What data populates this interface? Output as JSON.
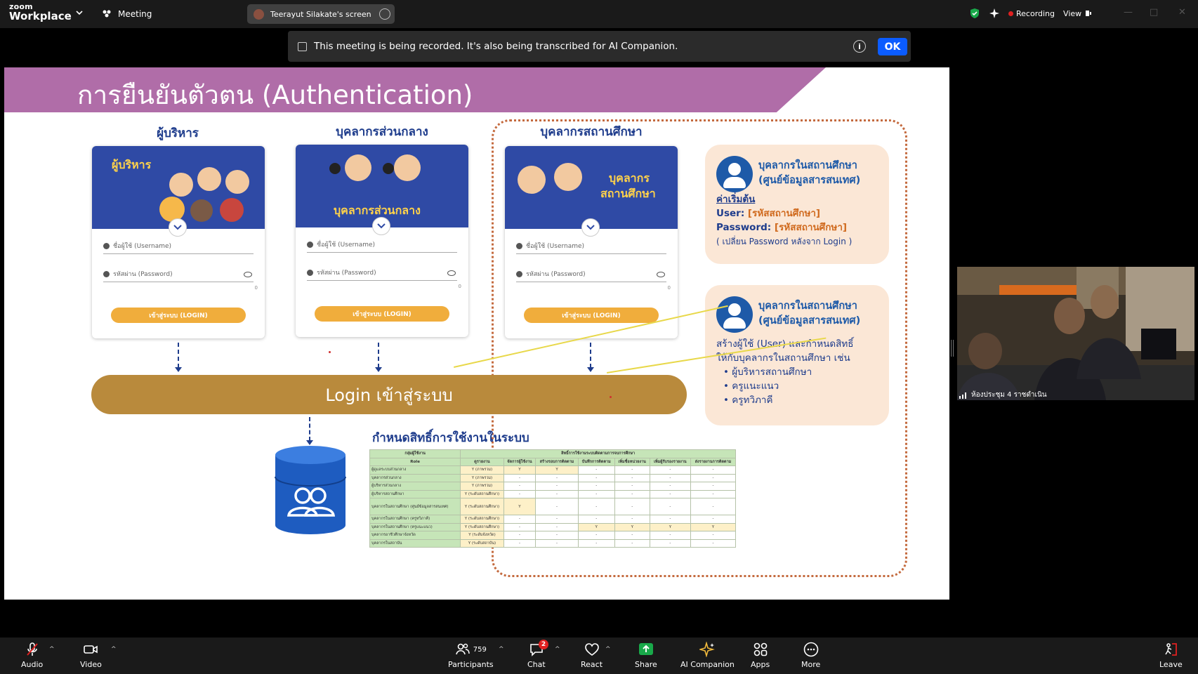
{
  "topbar": {
    "logo_line1": "zoom",
    "logo_line2": "Workplace",
    "meeting_label": "Meeting",
    "share_tab_label": "Teerayut Silakate's screen",
    "recording_label": "Recording",
    "view_label": "View"
  },
  "notice": {
    "text": "This meeting is being recorded. It's also being transcribed for AI Companion.",
    "info_glyph": "i",
    "ok_label": "OK"
  },
  "slide": {
    "title": "การยืนยันตัวตน (Authentication)",
    "columns": [
      {
        "heading": "ผู้บริหาร",
        "image_label": "ผู้บริหาร",
        "username_placeholder": "ชื่อผู้ใช้ (Username)",
        "password_placeholder": "รหัสผ่าน (Password)",
        "counter": "0",
        "login_label": "เข้าสู่ระบบ (LOGIN)"
      },
      {
        "heading": "บุคลากรส่วนกลาง",
        "image_label": "บุคลากรส่วนกลาง",
        "username_placeholder": "ชื่อผู้ใช้ (Username)",
        "password_placeholder": "รหัสผ่าน (Password)",
        "counter": "0",
        "login_label": "เข้าสู่ระบบ (LOGIN)"
      },
      {
        "heading": "บุคลากรสถานศึกษา",
        "image_label_1": "บุคลากร",
        "image_label_2": "สถานศึกษา",
        "username_placeholder": "ชื่อผู้ใช้ (Username)",
        "password_placeholder": "รหัสผ่าน (Password)",
        "counter": "0",
        "login_label": "เข้าสู่ระบบ (LOGIN)"
      }
    ],
    "login_bar": "Login เข้าสู่ระบบ",
    "info_card_1": {
      "title_1": "บุคลากรในสถานศึกษา",
      "title_2": "(ศูนย์ข้อมูลสารสนเทศ)",
      "default_heading": "ค่าเริ่มต้น",
      "user_label": "User",
      "user_value": "[รหัสสถานศึกษา]",
      "password_label": "Password",
      "password_value": "[รหัสสถานศึกษา]",
      "note": "( เปลี่ยน Password หลังจาก Login )"
    },
    "info_card_2": {
      "title_1": "บุคลากรในสถานศึกษา",
      "title_2": "(ศูนย์ข้อมูลสารสนเทศ)",
      "desc_1": "สร้างผู้ใช้ (User) และกำหนดสิทธิ์",
      "desc_2": "ให้กับบุคลากรในสถานศึกษา เช่น",
      "items": [
        "ผู้บริหารสถานศึกษา",
        "ครูแนะแนว",
        "ครูทวิภาคี"
      ]
    },
    "permissions_title": "กำหนดสิทธิ์การใช้งานในระบบ",
    "permissions_table": {
      "header_row_1": [
        "กลุ่มผู้ใช้งาน",
        "สิทธิ์การใช้งานระบบติดตามการจบการศึกษา"
      ],
      "header_row_2": [
        "Role",
        "ดูรายงาน",
        "จัดการผู้ใช้งาน",
        "สร้างรอบการติดตาม",
        "บันทึกการติดตาม",
        "เพิ่มชื่อหน่วยงาน",
        "เพิ่มผู้รับรองรายงาน",
        "ส่งรายงานการติดตาม"
      ],
      "rows": [
        {
          "role": "ผู้ดูแลระบบส่วนกลาง",
          "cells": [
            "Y (ภาพรวม)",
            "Y",
            "Y",
            "-",
            "-",
            "-",
            "-"
          ]
        },
        {
          "role": "บุคลากรส่วนกลาง",
          "cells": [
            "Y (ภาพรวม)",
            "-",
            "-",
            "-",
            "-",
            "-",
            "-"
          ]
        },
        {
          "role": "ผู้บริหารส่วนกลาง",
          "cells": [
            "Y (ภาพรวม)",
            "-",
            "-",
            "-",
            "-",
            "-",
            "-"
          ]
        },
        {
          "role": "ผู้บริหารสถานศึกษา",
          "cells": [
            "Y (ระดับสถานศึกษา)",
            "-",
            "-",
            "-",
            "-",
            "-",
            "-"
          ]
        },
        {
          "role": "บุคลากรในสถานศึกษา (ศูนย์ข้อมูลสารสนเทศ)",
          "cells": [
            "Y (ระดับสถานศึกษา)",
            "Y",
            "-",
            "-",
            "-",
            "-",
            "-"
          ],
          "tall": true
        },
        {
          "role": "บุคลากรในสถานศึกษา (ครูทวิภาคี)",
          "cells": [
            "Y (ระดับสถานศึกษา)",
            "-",
            "-",
            "-",
            "-",
            "-",
            "-"
          ]
        },
        {
          "role": "บุคลากรในสถานศึกษา (ครูแนะแนว)",
          "cells": [
            "Y (ระดับสถานศึกษา)",
            "-",
            "-",
            "Y",
            "Y",
            "Y",
            "Y"
          ]
        },
        {
          "role": "บุคลากรอาชีวศึกษาจังหวัด",
          "cells": [
            "Y (ระดับจังหวัด)",
            "-",
            "-",
            "-",
            "-",
            "-",
            "-"
          ]
        },
        {
          "role": "บุคลากรในสถาบัน",
          "cells": [
            "Y (ระดับสถาบัน)",
            "-",
            "-",
            "-",
            "-",
            "-",
            "-"
          ]
        }
      ]
    }
  },
  "video": {
    "label": "ห้องประชุม 4 ราชดำเนิน"
  },
  "toolbar": {
    "audio": "Audio",
    "video": "Video",
    "participants": "Participants",
    "participants_count": "759",
    "chat": "Chat",
    "chat_badge": "2",
    "react": "React",
    "share": "Share",
    "ai_companion": "AI Companion",
    "apps": "Apps",
    "more": "More",
    "leave": "Leave"
  },
  "colors": {
    "slide_purple": "#b06da8",
    "login_gold": "#b98a3c",
    "zoom_blue": "#0b5cff",
    "share_green": "#19a94a"
  }
}
